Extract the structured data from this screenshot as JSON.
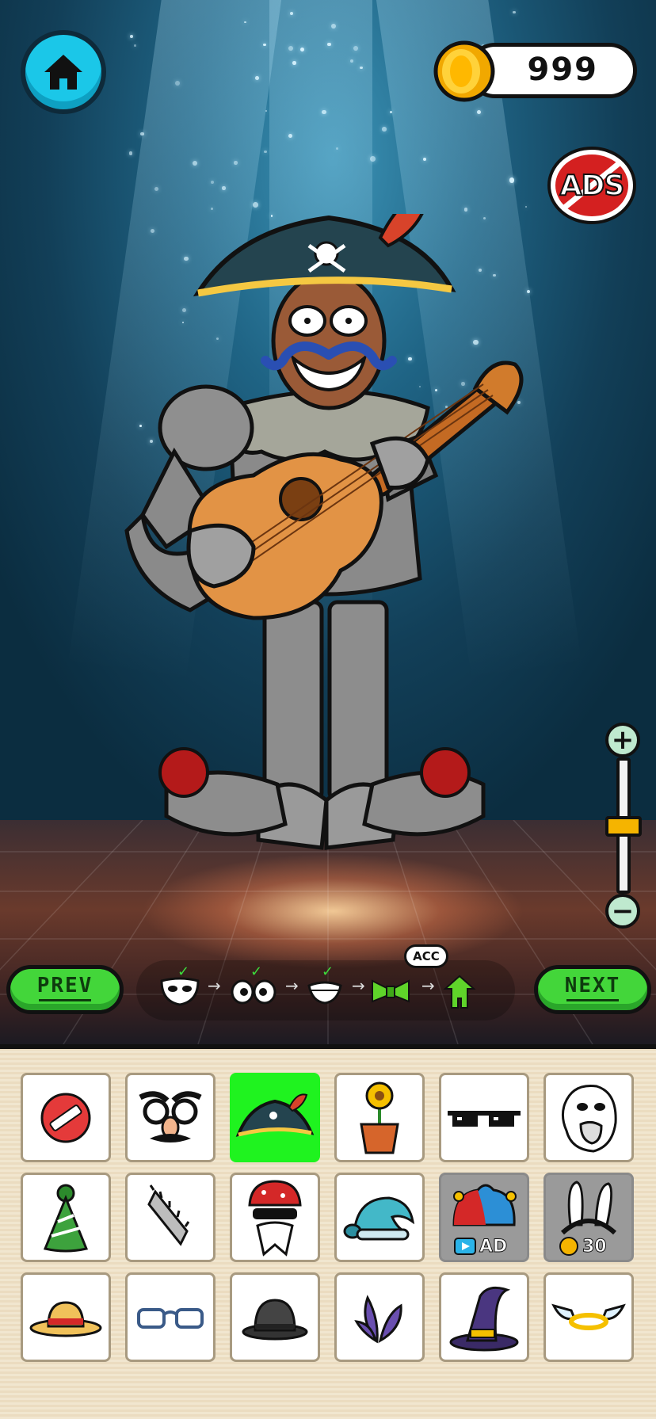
{
  "hud": {
    "coins": "999",
    "ads_label": "ADS"
  },
  "nav": {
    "prev_label": "PREV",
    "next_label": "NEXT"
  },
  "steps": {
    "items": [
      {
        "icon": "mask-icon",
        "done": true
      },
      {
        "icon": "eyes-icon",
        "done": true
      },
      {
        "icon": "mouth-icon",
        "done": true
      },
      {
        "icon": "bowtie-icon",
        "done": false,
        "current_label": "ACC"
      },
      {
        "icon": "outfit-icon",
        "done": false
      }
    ]
  },
  "zoom": {
    "plus_label": "+",
    "minus_label": "−",
    "level": 0.5
  },
  "items": [
    {
      "icon": "none-icon"
    },
    {
      "icon": "groucho-glasses-icon"
    },
    {
      "icon": "pirate-hat-icon",
      "selected": true
    },
    {
      "icon": "flower-pot-icon"
    },
    {
      "icon": "pixel-sunglasses-icon"
    },
    {
      "icon": "troll-face-icon"
    },
    {
      "icon": "party-hat-icon"
    },
    {
      "icon": "chainsaw-icon"
    },
    {
      "icon": "bandana-beard-icon"
    },
    {
      "icon": "sleep-cap-icon"
    },
    {
      "icon": "jester-hat-icon",
      "locked": true,
      "badge": "AD"
    },
    {
      "icon": "bunny-ears-icon",
      "locked": true,
      "badge": "30"
    },
    {
      "icon": "straw-hat-icon"
    },
    {
      "icon": "glasses-icon"
    },
    {
      "icon": "bowler-hat-icon"
    },
    {
      "icon": "leaf-sprout-icon"
    },
    {
      "icon": "witch-hat-icon"
    },
    {
      "icon": "angel-halo-icon"
    }
  ],
  "colors": {
    "selected": "#1ff31f",
    "button_green": "#43d63a",
    "home_cyan": "#1bc7e8",
    "coin_gold": "#f5b400",
    "ads_red": "#d42020"
  }
}
